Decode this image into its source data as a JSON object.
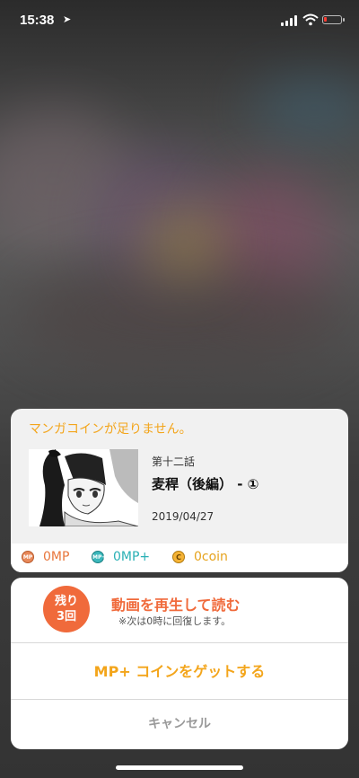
{
  "status_bar": {
    "time": "15:38"
  },
  "dialog": {
    "alert": "マンガコインが足りません。",
    "episode": {
      "number": "第十二話",
      "title": "麦稈（後編） - ①",
      "date": "2019/04/27"
    },
    "balances": {
      "mp": {
        "icon": "MP",
        "value": "0MP"
      },
      "mp_plus": {
        "icon": "MP+",
        "value": "0MP+"
      },
      "coin": {
        "icon": "C",
        "value": "0coin"
      }
    }
  },
  "actions": {
    "remaining_line1": "残り",
    "remaining_line2": "3回",
    "video_label": "動画を再生して読む",
    "video_note": "※次は0時に回復します。",
    "get_coin_label": "MP+ コインをゲットする",
    "cancel_label": "キャンセル"
  },
  "colors": {
    "accent_orange": "#f06a3b",
    "accent_yellow": "#f3a51b",
    "teal": "#2ab0b5"
  }
}
